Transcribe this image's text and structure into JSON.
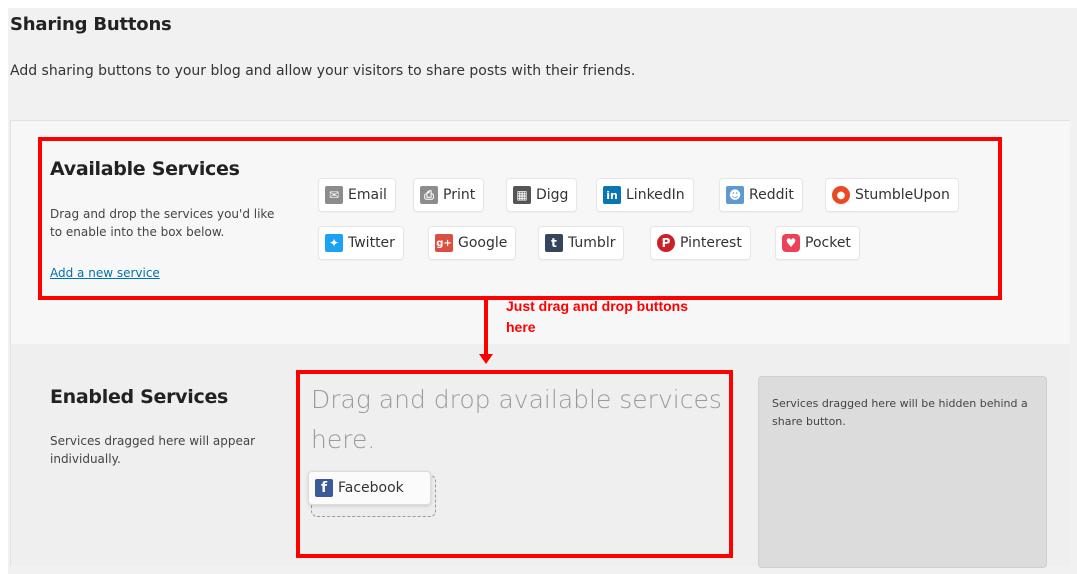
{
  "page": {
    "title": "Sharing Buttons",
    "description": "Add sharing buttons to your blog and allow your visitors to share posts with their friends."
  },
  "available": {
    "title": "Available Services",
    "description": "Drag and drop the services you'd like to enable into the box below.",
    "add_link": "Add a new service",
    "services": [
      {
        "label": "Email",
        "icon": "email-icon",
        "glyph": "✉",
        "color": "#8c8c8c"
      },
      {
        "label": "Print",
        "icon": "print-icon",
        "glyph": "⎙",
        "color": "#8c8c8c"
      },
      {
        "label": "Digg",
        "icon": "digg-icon",
        "glyph": "▦",
        "color": "#555555"
      },
      {
        "label": "LinkedIn",
        "icon": "linkedin-icon",
        "glyph": "in",
        "color": "#0976b4"
      },
      {
        "label": "Reddit",
        "icon": "reddit-icon",
        "glyph": "☻",
        "color": "#5f99cf"
      },
      {
        "label": "StumbleUpon",
        "icon": "stumbleupon-icon",
        "glyph": "ᔕ",
        "color": "#eb4924"
      },
      {
        "label": "Twitter",
        "icon": "twitter-icon",
        "glyph": "✦",
        "color": "#1da1f2"
      },
      {
        "label": "Google",
        "icon": "google-plus-icon",
        "glyph": "g+",
        "color": "#dc4e41"
      },
      {
        "label": "Tumblr",
        "icon": "tumblr-icon",
        "glyph": "t",
        "color": "#35465c"
      },
      {
        "label": "Pinterest",
        "icon": "pinterest-icon",
        "glyph": "P",
        "color": "#cb2027"
      },
      {
        "label": "Pocket",
        "icon": "pocket-icon",
        "glyph": "♥",
        "color": "#ee4056"
      }
    ]
  },
  "annotation": {
    "line1": "Just drag and drop buttons",
    "line2": "here"
  },
  "enabled": {
    "title": "Enabled Services",
    "description": "Services dragged here will appear individually.",
    "drop_placeholder": "Drag and drop available services here.",
    "dragging_service": {
      "label": "Facebook",
      "icon": "facebook-icon",
      "glyph": "f",
      "color": "#3b5998"
    },
    "hidden_text": "Services dragged here will be hidden behind a share button."
  },
  "colors": {
    "callout": "#ff0000",
    "link": "#0073aa"
  }
}
